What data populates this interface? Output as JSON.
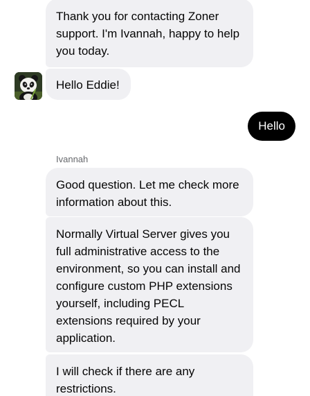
{
  "conversation": {
    "agent_name": "Ivannah",
    "messages": [
      {
        "text": "Thank you for contacting Zoner support. I'm Ivannah, happy to help you today."
      },
      {
        "text": "Hello Eddie!"
      },
      {
        "text": "Hello"
      },
      {
        "text": "Good question. Let me check more information about this."
      },
      {
        "text": "Normally Virtual Server gives you full administrative access to the environment, so you can install and configure custom PHP extensions yourself, including PECL extensions required by your application."
      },
      {
        "text": "I will check if there are any restrictions."
      }
    ]
  },
  "icons": {
    "agent_avatar": "panda-avatar-icon"
  },
  "colors": {
    "incoming_bubble": "#f0f0f3",
    "outgoing_bubble": "#000000",
    "outgoing_text": "#ffffff",
    "sender_label": "#65676b"
  }
}
